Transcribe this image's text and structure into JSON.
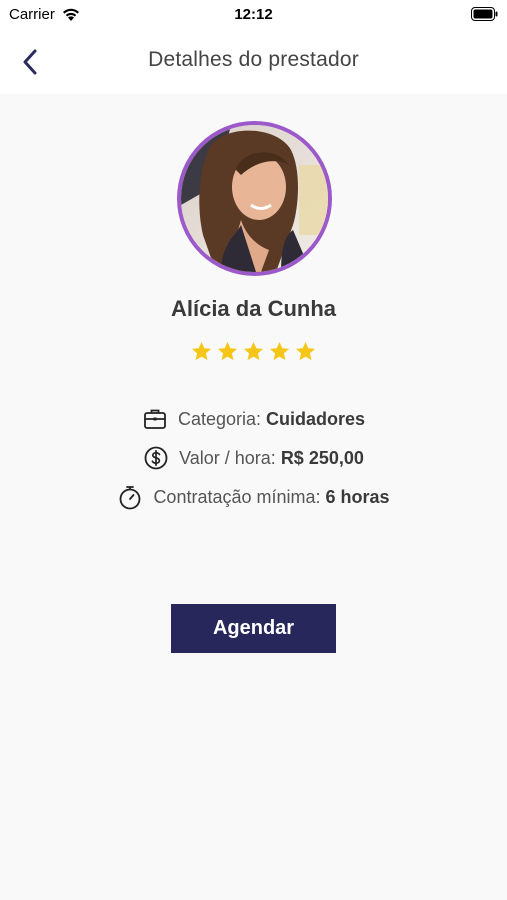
{
  "status_bar": {
    "carrier": "Carrier",
    "time": "12:12"
  },
  "nav": {
    "title": "Detalhes do prestador",
    "back_icon": "chevron-left-icon"
  },
  "provider": {
    "name": "Alícia da Cunha",
    "rating": 5,
    "rating_max": 5,
    "avatar_border_color": "#9b59c9"
  },
  "info": {
    "category": {
      "label": "Categoria:",
      "value": "Cuidadores",
      "icon": "briefcase-icon"
    },
    "price": {
      "label": "Valor / hora:",
      "value": "R$ 250,00",
      "icon": "dollar-circle-icon"
    },
    "minimum": {
      "label": "Contratação mínima:",
      "value": "6 horas",
      "icon": "stopwatch-icon"
    }
  },
  "actions": {
    "schedule_label": "Agendar"
  },
  "colors": {
    "accent": "#27275c",
    "star": "#f5c518",
    "background": "#f9f9f9"
  }
}
